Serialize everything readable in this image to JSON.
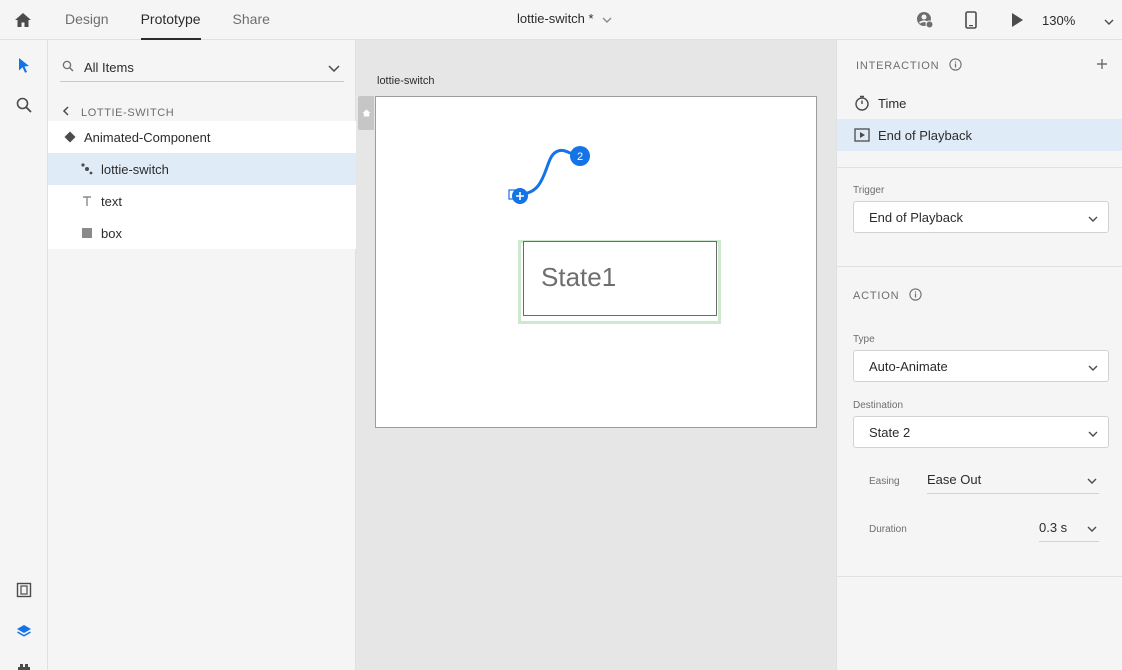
{
  "header": {
    "tabs": [
      {
        "label": "Design"
      },
      {
        "label": "Prototype"
      },
      {
        "label": "Share"
      }
    ],
    "doc_title": "lottie-switch *",
    "zoom": "130%"
  },
  "layers": {
    "search_placeholder": "All Items",
    "breadcrumb": "LOTTIE-SWITCH",
    "items": [
      {
        "label": "Animated-Component"
      },
      {
        "label": "lottie-switch"
      },
      {
        "label": "text"
      },
      {
        "label": "box"
      }
    ]
  },
  "canvas": {
    "artboard_label": "lottie-switch",
    "component_text": "State1",
    "wire_badge": "2"
  },
  "props": {
    "interaction_title": "INTERACTION",
    "interactions": [
      {
        "label": "Time"
      },
      {
        "label": "End of Playback"
      }
    ],
    "trigger_label": "Trigger",
    "trigger_value": "End of Playback",
    "action_title": "ACTION",
    "type_label": "Type",
    "type_value": "Auto-Animate",
    "destination_label": "Destination",
    "destination_value": "State 2",
    "easing_label": "Easing",
    "easing_value": "Ease Out",
    "duration_label": "Duration",
    "duration_value": "0.3 s"
  },
  "colors": {
    "accent": "#1473e6",
    "selection": "#dfecf8",
    "component_highlight": "#cfe9cf"
  }
}
